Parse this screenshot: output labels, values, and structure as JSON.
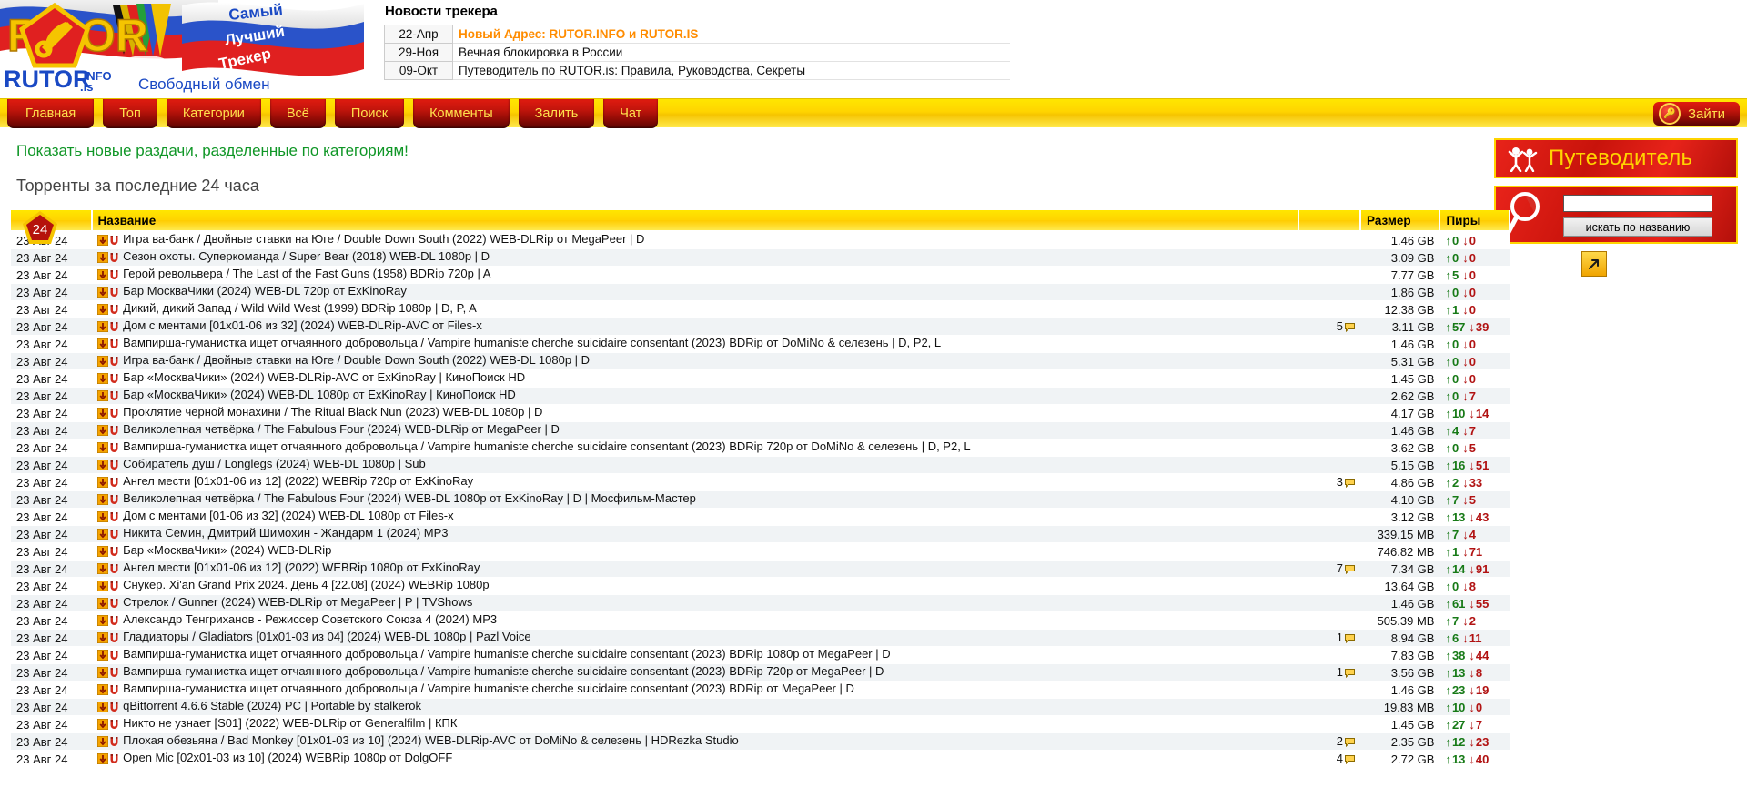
{
  "site": {
    "logo_main": "RUTOR",
    "logo_info": "INFO",
    "logo_is": "is",
    "logo_tagline": "Свободный обмен",
    "ribbon_1": "Самый",
    "ribbon_2": "Лучший",
    "ribbon_3": "Трекер"
  },
  "news": {
    "title": "Новости трекера",
    "items": [
      {
        "date": "22-Апр",
        "text": "Новый Адрес: RUTOR.INFO и RUTOR.IS",
        "hot": true
      },
      {
        "date": "29-Ноя",
        "text": "Вечная блокировка в России",
        "hot": false
      },
      {
        "date": "09-Окт",
        "text": "Путеводитель по RUTOR.is: Правила, Руководства, Секреты",
        "hot": false
      }
    ]
  },
  "nav": {
    "items": [
      "Главная",
      "Топ",
      "Категории",
      "Всё",
      "Поиск",
      "Комменты",
      "Залить",
      "Чат"
    ],
    "login_label": "Зайти",
    "login_icon": "key-icon"
  },
  "main": {
    "categories_link": "Показать новые раздачи, разделенные по категориям!",
    "page_title": "Торренты за последние 24 часа",
    "badge": "24"
  },
  "rightbox": {
    "guide_label": "Путеводитель",
    "guide_icon": "people-icon",
    "search_icon": "magnifier-icon",
    "search_value": "",
    "search_placeholder": "",
    "search_button": "искать по названию",
    "arrow_icon": "arrow-up-right-icon"
  },
  "table": {
    "columns": [
      "",
      "Название",
      "",
      "Размер",
      "Пиры"
    ],
    "col_name": "Название",
    "col_size": "Размер",
    "col_peers": "Пиры",
    "rows": [
      {
        "date": "23 Авг 24",
        "name": "Игра ва-банк / Двойные ставки на Юге / Double Down South (2022) WEB-DLRip от MegaPeer | D",
        "comments": "",
        "size": "1.46 GB",
        "seeds": "0",
        "leech": "0"
      },
      {
        "date": "23 Авг 24",
        "name": "Сезон охоты. Суперкоманда / Super Bear (2018) WEB-DL 1080p | D",
        "comments": "",
        "size": "3.09 GB",
        "seeds": "0",
        "leech": "0"
      },
      {
        "date": "23 Авг 24",
        "name": "Герой револьвера / The Last of the Fast Guns (1958) BDRip 720p | A",
        "comments": "",
        "size": "7.77 GB",
        "seeds": "5",
        "leech": "0"
      },
      {
        "date": "23 Авг 24",
        "name": "Бар МоскваЧики (2024) WEB-DL 720p от ExKinoRay",
        "comments": "",
        "size": "1.86 GB",
        "seeds": "0",
        "leech": "0"
      },
      {
        "date": "23 Авг 24",
        "name": "Дикий, дикий Запад / Wild Wild West (1999) BDRip 1080p | D, P, A",
        "comments": "",
        "size": "12.38 GB",
        "seeds": "1",
        "leech": "0"
      },
      {
        "date": "23 Авг 24",
        "name": "Дом с ментами [01x01-06 из 32] (2024) WEB-DLRip-AVC от Files-x",
        "comments": "5",
        "size": "3.11 GB",
        "seeds": "57",
        "leech": "39"
      },
      {
        "date": "23 Авг 24",
        "name": "Вампирша-гуманистка ищет отчаянного добровольца / Vampire humaniste cherche suicidaire consentant (2023) BDRip от DoMiNo & селезень | D, P2, L",
        "comments": "",
        "size": "1.46 GB",
        "seeds": "0",
        "leech": "0"
      },
      {
        "date": "23 Авг 24",
        "name": "Игра ва-банк / Двойные ставки на Юге / Double Down South (2022) WEB-DL 1080p | D",
        "comments": "",
        "size": "5.31 GB",
        "seeds": "0",
        "leech": "0"
      },
      {
        "date": "23 Авг 24",
        "name": "Бар «МоскваЧики» (2024) WEB-DLRip-AVC от ExKinoRay | КиноПоиск HD",
        "comments": "",
        "size": "1.45 GB",
        "seeds": "0",
        "leech": "0"
      },
      {
        "date": "23 Авг 24",
        "name": "Бар «МоскваЧики» (2024) WEB-DL 1080p от ExKinoRay | КиноПоиск HD",
        "comments": "",
        "size": "2.62 GB",
        "seeds": "0",
        "leech": "7"
      },
      {
        "date": "23 Авг 24",
        "name": "Проклятие черной монахини / The Ritual Black Nun (2023) WEB-DL 1080p | D",
        "comments": "",
        "size": "4.17 GB",
        "seeds": "10",
        "leech": "14"
      },
      {
        "date": "23 Авг 24",
        "name": "Великолепная четвёрка / The Fabulous Four (2024) WEB-DLRip от MegaPeer | D",
        "comments": "",
        "size": "1.46 GB",
        "seeds": "4",
        "leech": "7"
      },
      {
        "date": "23 Авг 24",
        "name": "Вампирша-гуманистка ищет отчаянного добровольца / Vampire humaniste cherche suicidaire consentant (2023) BDRip 720p от DoMiNo & селезень | D, P2, L",
        "comments": "",
        "size": "3.62 GB",
        "seeds": "0",
        "leech": "5"
      },
      {
        "date": "23 Авг 24",
        "name": "Собиратель душ / Longlegs (2024) WEB-DL 1080p | Sub",
        "comments": "",
        "size": "5.15 GB",
        "seeds": "16",
        "leech": "51"
      },
      {
        "date": "23 Авг 24",
        "name": "Ангел мести [01x01-06 из 12] (2022) WEBRip 720p от ExKinoRay",
        "comments": "3",
        "size": "4.86 GB",
        "seeds": "2",
        "leech": "33"
      },
      {
        "date": "23 Авг 24",
        "name": "Великолепная четвёрка / The Fabulous Four (2024) WEB-DL 1080p от ExKinoRay | D | Мосфильм-Мастер",
        "comments": "",
        "size": "4.10 GB",
        "seeds": "7",
        "leech": "5"
      },
      {
        "date": "23 Авг 24",
        "name": "Дом с ментами [01-06 из 32] (2024) WEB-DL 1080p от Files-x",
        "comments": "",
        "size": "3.12 GB",
        "seeds": "13",
        "leech": "43"
      },
      {
        "date": "23 Авг 24",
        "name": "Никита Семин, Дмитрий Шимохин - Жандарм 1 (2024) MP3",
        "comments": "",
        "size": "339.15 MB",
        "seeds": "7",
        "leech": "4"
      },
      {
        "date": "23 Авг 24",
        "name": "Бар «МоскваЧики» (2024) WEB-DLRip",
        "comments": "",
        "size": "746.82 MB",
        "seeds": "1",
        "leech": "71"
      },
      {
        "date": "23 Авг 24",
        "name": "Ангел мести [01x01-06 из 12] (2022) WEBRip 1080p от ExKinoRay",
        "comments": "7",
        "size": "7.34 GB",
        "seeds": "14",
        "leech": "91"
      },
      {
        "date": "23 Авг 24",
        "name": "Снукер. Xi'an Grand Prix 2024. День 4 [22.08] (2024) WEBRip 1080p",
        "comments": "",
        "size": "13.64 GB",
        "seeds": "0",
        "leech": "8"
      },
      {
        "date": "23 Авг 24",
        "name": "Стрелок / Gunner (2024) WEB-DLRip от MegaPeer | P | TVShows",
        "comments": "",
        "size": "1.46 GB",
        "seeds": "61",
        "leech": "55"
      },
      {
        "date": "23 Авг 24",
        "name": "Александр Тенгриханов - Режиссер Советского Союза 4 (2024) MP3",
        "comments": "",
        "size": "505.39 MB",
        "seeds": "7",
        "leech": "2"
      },
      {
        "date": "23 Авг 24",
        "name": "Гладиаторы / Gladiators [01x01-03 из 04] (2024) WEB-DL 1080p | Pazl Voice",
        "comments": "1",
        "size": "8.94 GB",
        "seeds": "6",
        "leech": "11"
      },
      {
        "date": "23 Авг 24",
        "name": "Вампирша-гуманистка ищет отчаянного добровольца / Vampire humaniste cherche suicidaire consentant (2023) BDRip 1080p от MegaPeer | D",
        "comments": "",
        "size": "7.83 GB",
        "seeds": "38",
        "leech": "44"
      },
      {
        "date": "23 Авг 24",
        "name": "Вампирша-гуманистка ищет отчаянного добровольца / Vampire humaniste cherche suicidaire consentant (2023) BDRip 720p от MegaPeer | D",
        "comments": "1",
        "size": "3.56 GB",
        "seeds": "13",
        "leech": "8"
      },
      {
        "date": "23 Авг 24",
        "name": "Вампирша-гуманистка ищет отчаянного добровольца / Vampire humaniste cherche suicidaire consentant (2023) BDRip от MegaPeer | D",
        "comments": "",
        "size": "1.46 GB",
        "seeds": "23",
        "leech": "19"
      },
      {
        "date": "23 Авг 24",
        "name": "qBittorrent 4.6.6 Stable (2024) PC | Portable by stalkerok",
        "comments": "",
        "size": "19.83 MB",
        "seeds": "10",
        "leech": "0"
      },
      {
        "date": "23 Авг 24",
        "name": "Никто не узнает [S01] (2022) WEB-DLRip от Generalfilm | КПК",
        "comments": "",
        "size": "1.45 GB",
        "seeds": "27",
        "leech": "7"
      },
      {
        "date": "23 Авг 24",
        "name": "Плохая обезьяна / Bad Monkey [01x01-03 из 10] (2024) WEB-DLRip-AVC от DoMiNo & селезень | HDRezka Studio",
        "comments": "2",
        "size": "2.35 GB",
        "seeds": "12",
        "leech": "23"
      },
      {
        "date": "23 Авг 24",
        "name": "Open Mic [02x01-03 из 10] (2024) WEBRip 1080p от DolgOFF",
        "comments": "4",
        "size": "2.72 GB",
        "seeds": "13",
        "leech": "40"
      }
    ]
  },
  "colors": {
    "accent_yellow": "#ffd400",
    "accent_red": "#c8130b",
    "green_link": "#0f9626",
    "seed_green": "#177a17",
    "leech_red": "#b11212",
    "hot_orange": "#ff8c00"
  }
}
